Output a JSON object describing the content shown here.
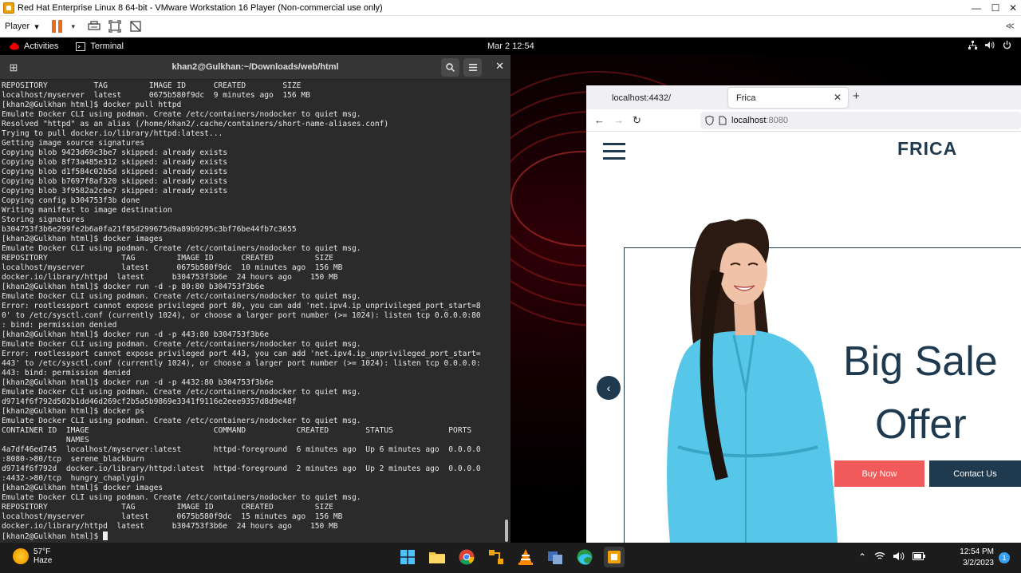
{
  "vm": {
    "title": "Red Hat Enterprise Linux 8 64-bit - VMware Workstation 16 Player (Non-commercial use only)",
    "player_menu": "Player",
    "collapse_label": "≪"
  },
  "gnome": {
    "activities": "Activities",
    "app_name": "Terminal",
    "clock": "Mar 2  12:54"
  },
  "terminal": {
    "title": "khan2@Gulkhan:~/Downloads/web/html",
    "lines": [
      "REPOSITORY          TAG         IMAGE ID      CREATED        SIZE",
      "localhost/myserver  latest      0675b580f9dc  9 minutes ago  156 MB",
      "[khan2@Gulkhan html]$ docker pull httpd",
      "Emulate Docker CLI using podman. Create /etc/containers/nodocker to quiet msg.",
      "Resolved \"httpd\" as an alias (/home/khan2/.cache/containers/short-name-aliases.conf)",
      "Trying to pull docker.io/library/httpd:latest...",
      "Getting image source signatures",
      "Copying blob 9423d69c3be7 skipped: already exists",
      "Copying blob 8f73a485e312 skipped: already exists",
      "Copying blob d1f584c02b5d skipped: already exists",
      "Copying blob b7697f8af320 skipped: already exists",
      "Copying blob 3f9582a2cbe7 skipped: already exists",
      "Copying config b304753f3b done",
      "Writing manifest to image destination",
      "Storing signatures",
      "b304753f3b6e299fe2b6a0fa21f85d299675d9a89b9295c3bf76be44fb7c3655",
      "[khan2@Gulkhan html]$ docker images",
      "Emulate Docker CLI using podman. Create /etc/containers/nodocker to quiet msg.",
      "REPOSITORY                TAG         IMAGE ID      CREATED         SIZE",
      "localhost/myserver        latest      0675b580f9dc  10 minutes ago  156 MB",
      "docker.io/library/httpd  latest      b304753f3b6e  24 hours ago    150 MB",
      "[khan2@Gulkhan html]$ docker run -d -p 80:80 b304753f3b6e",
      "Emulate Docker CLI using podman. Create /etc/containers/nodocker to quiet msg.",
      "Error: rootlessport cannot expose privileged port 80, you can add 'net.ipv4.ip_unprivileged_port_start=8",
      "0' to /etc/sysctl.conf (currently 1024), or choose a larger port number (>= 1024): listen tcp 0.0.0.0:80",
      ": bind: permission denied",
      "[khan2@Gulkhan html]$ docker run -d -p 443:80 b304753f3b6e",
      "Emulate Docker CLI using podman. Create /etc/containers/nodocker to quiet msg.",
      "Error: rootlessport cannot expose privileged port 443, you can add 'net.ipv4.ip_unprivileged_port_start=",
      "443' to /etc/sysctl.conf (currently 1024), or choose a larger port number (>= 1024): listen tcp 0.0.0.0:",
      "443: bind: permission denied",
      "[khan2@Gulkhan html]$ docker run -d -p 4432:80 b304753f3b6e",
      "Emulate Docker CLI using podman. Create /etc/containers/nodocker to quiet msg.",
      "d9714f6f792d502b1dd46d269cf2b5a5b9869e3341f9116e2eee9357d8d9e48f",
      "[khan2@Gulkhan html]$ docker ps",
      "Emulate Docker CLI using podman. Create /etc/containers/nodocker to quiet msg.",
      "CONTAINER ID  IMAGE                           COMMAND           CREATED        STATUS            PORTS",
      "              NAMES",
      "4a7df46ed745  localhost/myserver:latest       httpd-foreground  6 minutes ago  Up 6 minutes ago  0.0.0.0",
      ":8080->80/tcp  serene_blackburn",
      "d9714f6f792d  docker.io/library/httpd:latest  httpd-foreground  2 minutes ago  Up 2 minutes ago  0.0.0.0",
      ":4432->80/tcp  hungry_chaplygin",
      "[khan2@Gulkhan html]$ docker images",
      "Emulate Docker CLI using podman. Create /etc/containers/nodocker to quiet msg.",
      "REPOSITORY                TAG         IMAGE ID      CREATED         SIZE",
      "localhost/myserver        latest      0675b580f9dc  15 minutes ago  156 MB",
      "docker.io/library/httpd  latest      b304753f3b6e  24 hours ago    150 MB"
    ],
    "prompt": "[khan2@Gulkhan html]$ "
  },
  "browser": {
    "tabs": [
      {
        "label": "localhost:4432/",
        "active": false
      },
      {
        "label": "Frica",
        "active": true
      }
    ],
    "url_host": "localhost",
    "url_port": ":8080",
    "page": {
      "brand": "FRICA",
      "headline_line1": "Big Sale",
      "headline_line2": "Offer",
      "buy_label": "Buy Now",
      "contact_label": "Contact Us",
      "accent_color": "#f05a5a",
      "primary_color": "#1f3a4f"
    }
  },
  "taskbar": {
    "temperature": "57°F",
    "weather": "Haze",
    "time": "12:54 PM",
    "date": "3/2/2023",
    "notification_count": "1"
  }
}
